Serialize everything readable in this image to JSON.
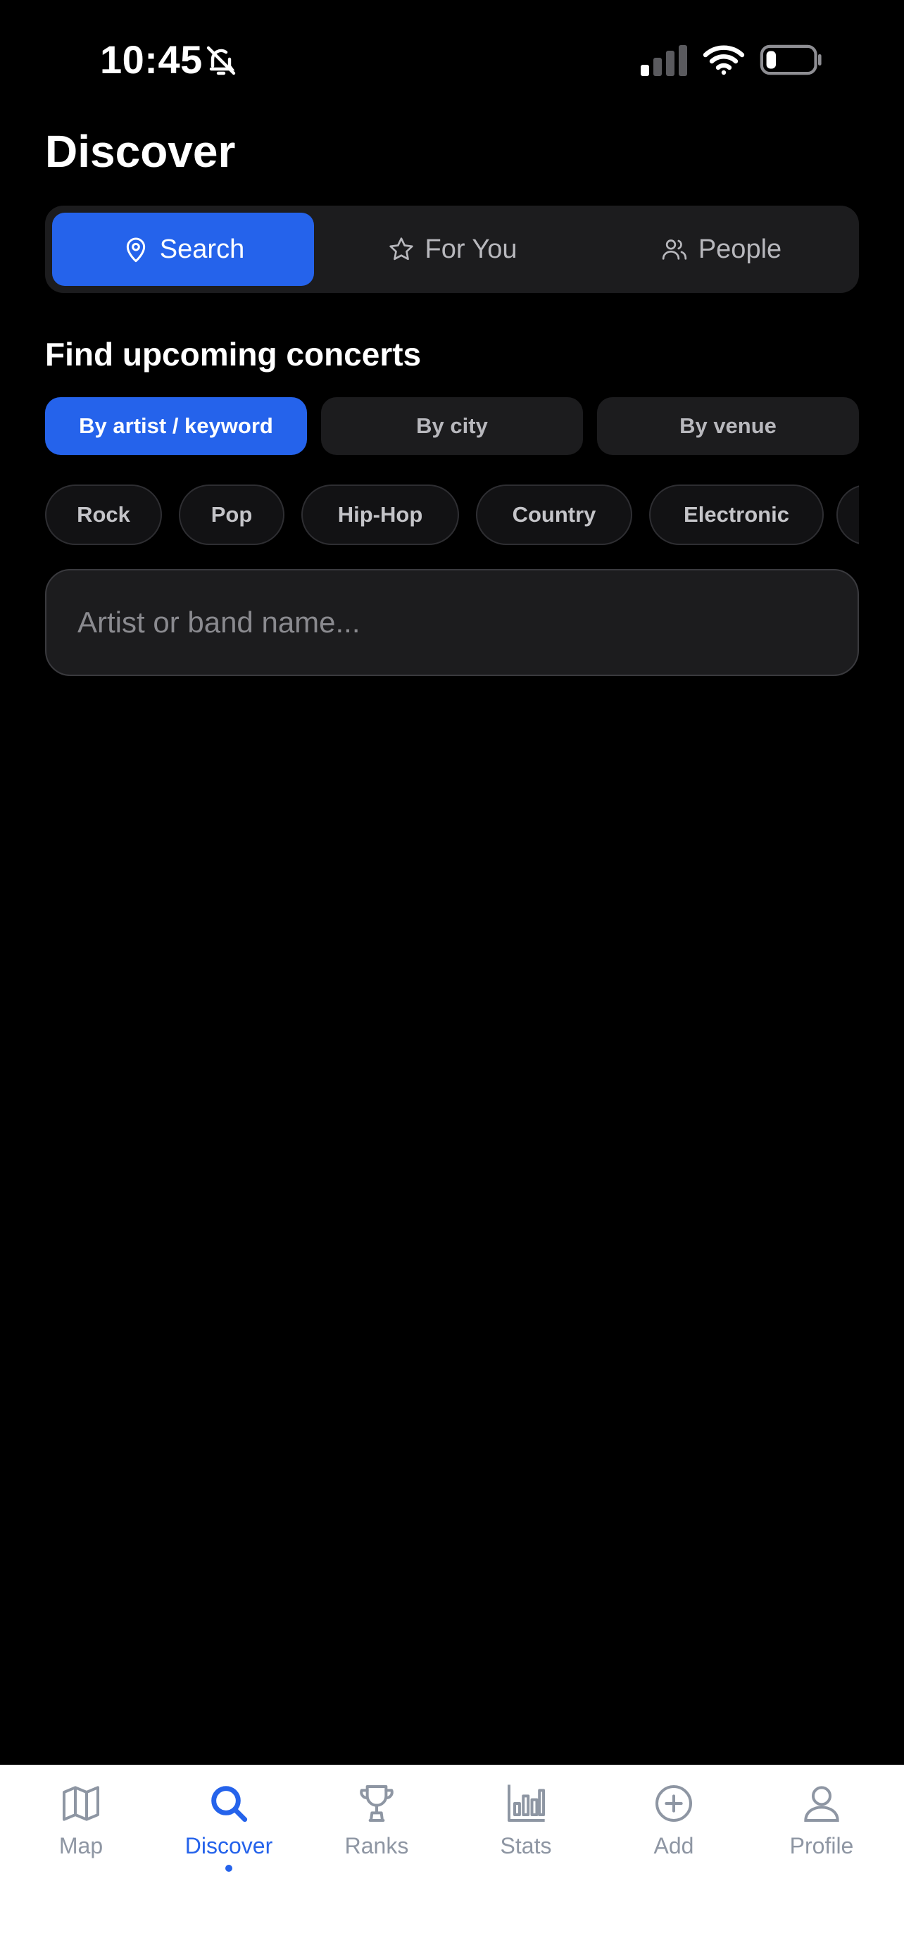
{
  "status_bar": {
    "time": "10:45"
  },
  "header": {
    "title": "Discover"
  },
  "segments": [
    {
      "label": "Search",
      "icon": "location-pin-icon",
      "active": true
    },
    {
      "label": "For You",
      "icon": "star-icon",
      "active": false
    },
    {
      "label": "People",
      "icon": "people-icon",
      "active": false
    }
  ],
  "section": {
    "title": "Find upcoming concerts"
  },
  "search_modes": [
    {
      "label": "By artist / keyword",
      "active": true
    },
    {
      "label": "By city",
      "active": false
    },
    {
      "label": "By venue",
      "active": false
    }
  ],
  "genres": [
    "Rock",
    "Pop",
    "Hip-Hop",
    "Country",
    "Electronic"
  ],
  "search": {
    "placeholder": "Artist or band name...",
    "value": ""
  },
  "tab_bar": {
    "tabs": [
      {
        "label": "Map",
        "icon": "map-icon",
        "active": false
      },
      {
        "label": "Discover",
        "icon": "search-icon",
        "active": true
      },
      {
        "label": "Ranks",
        "icon": "trophy-icon",
        "active": false
      },
      {
        "label": "Stats",
        "icon": "bar-chart-icon",
        "active": false
      },
      {
        "label": "Add",
        "icon": "plus-circle-icon",
        "active": false
      },
      {
        "label": "Profile",
        "icon": "person-icon",
        "active": false
      }
    ]
  },
  "colors": {
    "accent": "#2563eb",
    "background": "#000000",
    "surface": "#1c1c1e",
    "tab_inactive": "#8e96a3"
  }
}
